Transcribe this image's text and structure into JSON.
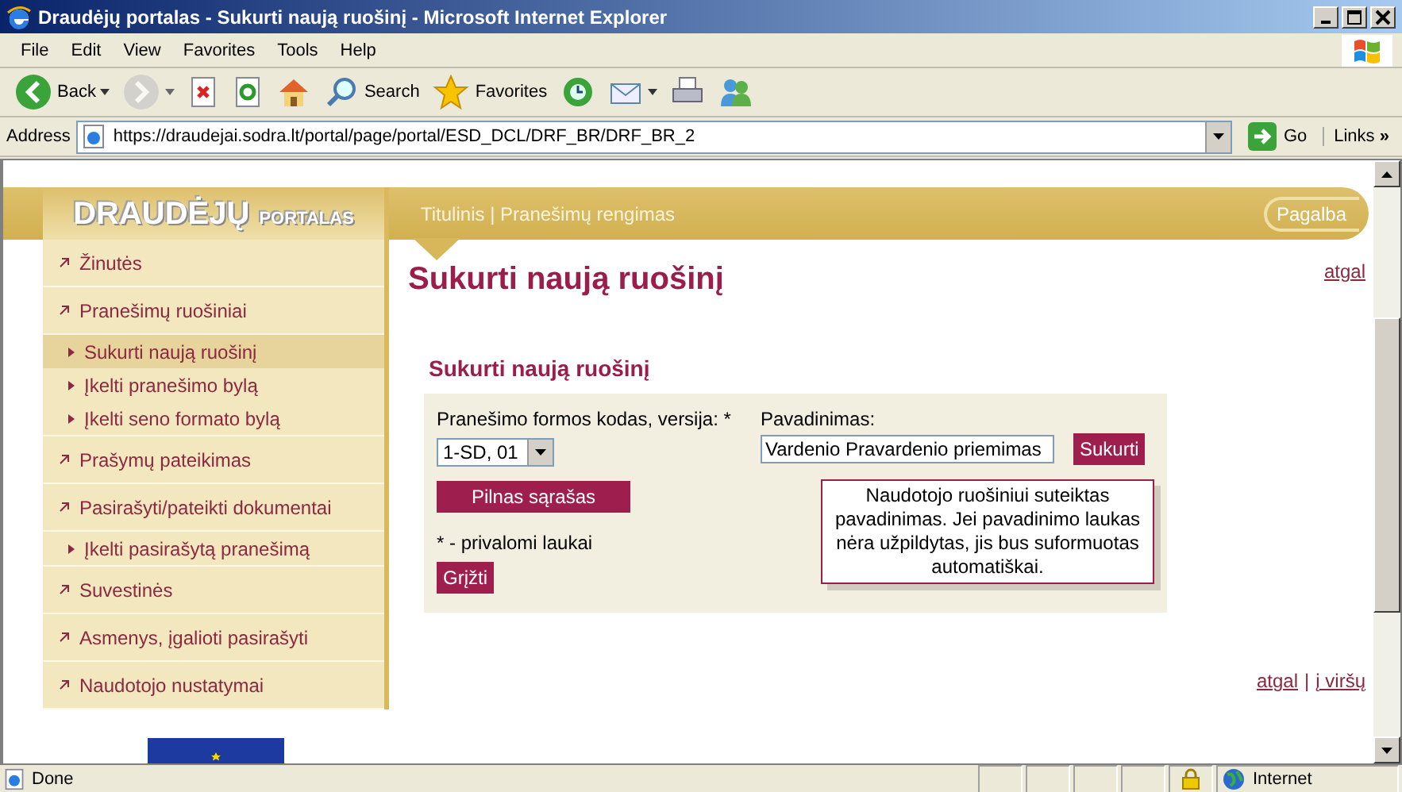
{
  "window": {
    "title": "Draudėjų portalas - Sukurti naują ruošinį - Microsoft Internet Explorer"
  },
  "menu": [
    "File",
    "Edit",
    "View",
    "Favorites",
    "Tools",
    "Help"
  ],
  "toolbar": [
    {
      "kind": "back",
      "label": "Back",
      "dropdown": true,
      "disabled": false
    },
    {
      "kind": "forward",
      "dropdown": true,
      "disabled": true
    },
    {
      "kind": "stop",
      "dropdown": false,
      "disabled": false
    },
    {
      "kind": "refresh",
      "dropdown": false,
      "disabled": false
    },
    {
      "kind": "home",
      "dropdown": false,
      "disabled": false
    },
    {
      "kind": "search",
      "label": "Search",
      "dropdown": false,
      "disabled": false
    },
    {
      "kind": "favorites",
      "label": "Favorites",
      "dropdown": false,
      "disabled": false
    },
    {
      "kind": "media",
      "dropdown": false,
      "disabled": false
    },
    {
      "kind": "mail",
      "dropdown": true,
      "disabled": false
    },
    {
      "kind": "print",
      "dropdown": false,
      "disabled": false
    },
    {
      "kind": "messenger",
      "dropdown": false,
      "disabled": false
    }
  ],
  "address": {
    "label": "Address",
    "url": "https://draudejai.sodra.lt/portal/page/portal/ESD_DCL/DRF_BR/DRF_BR_2",
    "go": "Go",
    "links": "Links",
    "links_more": "»"
  },
  "page": {
    "logo": {
      "main": "DRAUDĖJŲ",
      "sub": "PORTALAS"
    },
    "breadcrumb": "Titulinis | Pranešimų rengimas",
    "help": "Pagalba",
    "sidebar": {
      "items": [
        {
          "label": "Žinutės",
          "selected": false
        },
        {
          "label": "Pranešimų ruošiniai",
          "selected": false,
          "children": [
            {
              "label": "Sukurti naują ruošinį",
              "selected": true
            },
            {
              "label": "Įkelti pranešimo bylą",
              "selected": false
            },
            {
              "label": "Įkelti seno formato bylą",
              "selected": false
            }
          ]
        },
        {
          "label": "Prašymų pateikimas",
          "selected": false
        },
        {
          "label": "Pasirašyti/pateikti dokumentai",
          "selected": false,
          "children": [
            {
              "label": "Įkelti pasirašytą pranešimą",
              "selected": false
            }
          ]
        },
        {
          "label": "Suvestinės",
          "selected": false
        },
        {
          "label": "Asmenys, įgalioti pasirašyti",
          "selected": false
        },
        {
          "label": "Naudotojo nustatymai",
          "selected": false
        }
      ]
    },
    "heading": "Sukurti naują ruošinį",
    "back_link": "atgal",
    "form": {
      "title": "Sukurti naują ruošinį",
      "code_label": "Pranešimo formos kodas, versija: *",
      "code_value": "1-SD, 01",
      "name_label": "Pavadinimas:",
      "name_value": "Vardenio Pravardenio priemimas",
      "create_button": "Sukurti",
      "full_list_button": "Pilnas sąrašas",
      "required_note": "* - privalomi laukai",
      "back_button": "Grįžti",
      "hint": "Naudotojo ruošiniui suteiktas pavadinimas. Jei pavadinimo laukas nėra užpildytas, jis bus suformuotas automatiškai."
    },
    "footer_links": [
      "atgal",
      "į viršų"
    ],
    "footer_separator": "|"
  },
  "status_bar": {
    "text": "Done",
    "zone": "Internet"
  }
}
